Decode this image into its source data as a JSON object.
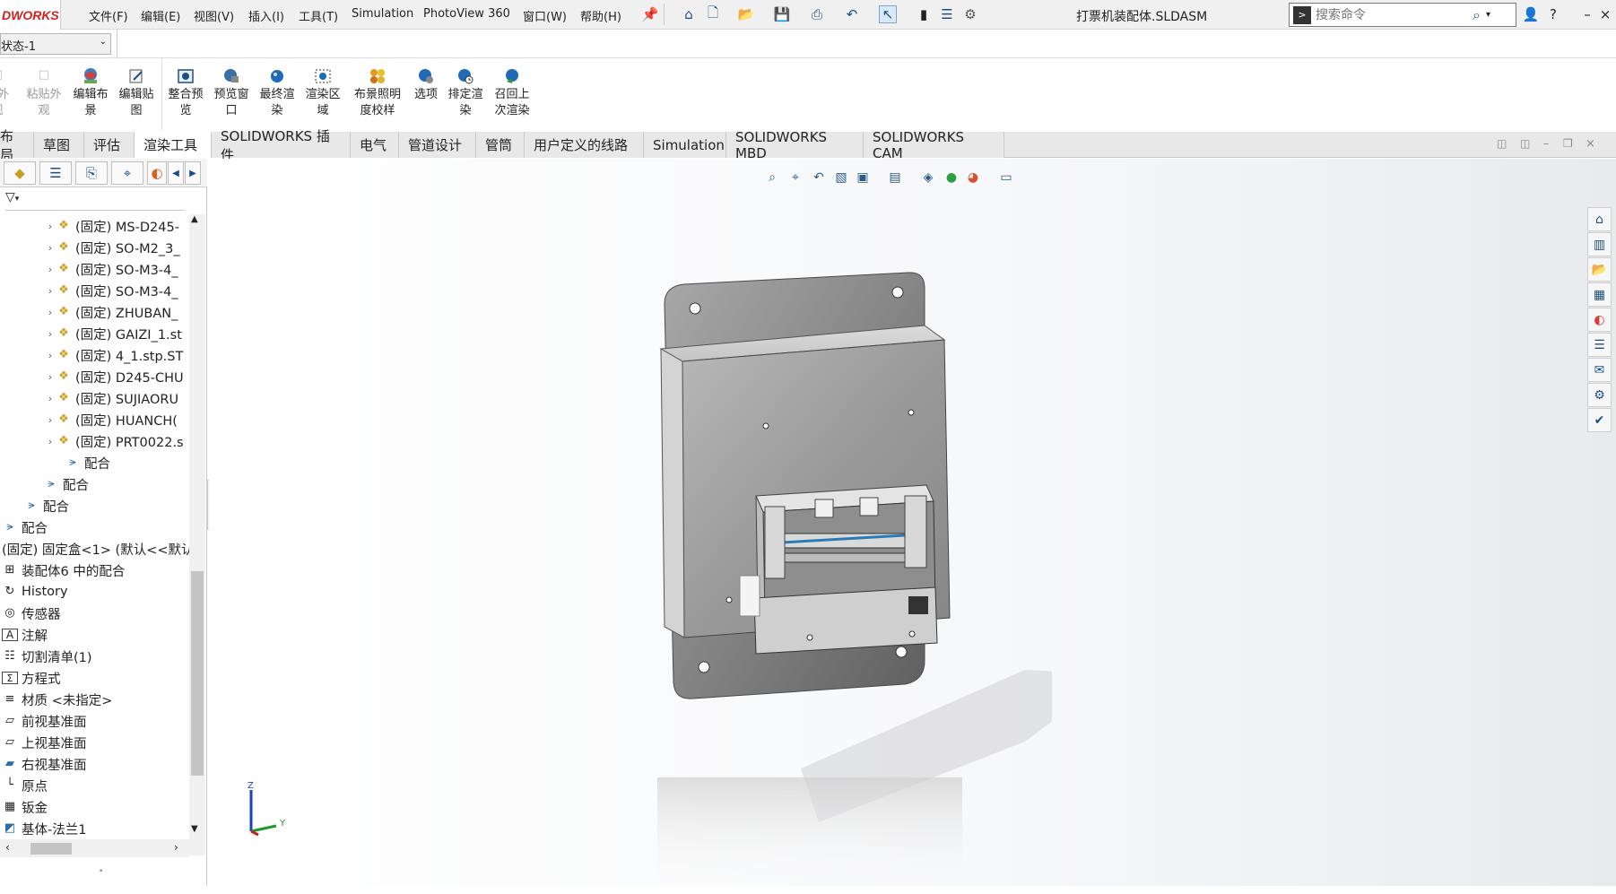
{
  "app": {
    "logo_text": "DWORKS",
    "document_title": "打票机装配体.SLDASM"
  },
  "menu": [
    "文件(F)",
    "编辑(E)",
    "视图(V)",
    "插入(I)",
    "工具(T)",
    "Simulation",
    "PhotoView 360",
    "窗口(W)",
    "帮助(H)"
  ],
  "search": {
    "placeholder": "搜索命令"
  },
  "config": {
    "value": "状态-1"
  },
  "ribbon": {
    "buttons": [
      {
        "label": "编辑布\n景",
        "icon": "scene-icon"
      },
      {
        "label": "编辑贴\n图",
        "icon": "decal-icon"
      },
      {
        "label": "整合预\n览",
        "icon": "integrated-preview-icon"
      },
      {
        "label": "预览窗\n口",
        "icon": "preview-window-icon"
      },
      {
        "label": "最终渲\n染",
        "icon": "final-render-icon"
      },
      {
        "label": "渲染区\n域",
        "icon": "render-region-icon"
      },
      {
        "label": "布景照明\n度校样",
        "icon": "scene-illumination-icon"
      },
      {
        "label": "选项",
        "icon": "options-icon"
      },
      {
        "label": "排定渲\n染",
        "icon": "schedule-render-icon"
      },
      {
        "label": "召回上\n次渲染",
        "icon": "recall-render-icon"
      }
    ],
    "disabled": [
      {
        "label": "粘贴外\n观"
      }
    ],
    "partial_left": "剪外\n观"
  },
  "tabs": [
    "布局",
    "草图",
    "评估",
    "渲染工具",
    "SOLIDWORKS 插件",
    "电气",
    "管道设计",
    "管筒",
    "用户定义的线路",
    "Simulation",
    "SOLIDWORKS MBD",
    "SOLIDWORKS CAM"
  ],
  "active_tab": "渲染工具",
  "tree": {
    "components": [
      "(固定) MS-D245-",
      "(固定) SO-M2_3_",
      "(固定) SO-M3-4_",
      "(固定) SO-M3-4_",
      "(固定) ZHUBAN_",
      "(固定) GAIZI_1.st",
      "(固定) 4_1.stp.ST",
      "(固定) D245-CHU",
      "(固定) SUJIAORU",
      "(固定) HUANCH(",
      "(固定) PRT0022.s"
    ],
    "mates": [
      "配合",
      "配合",
      "配合",
      "配合"
    ],
    "root_items": [
      {
        "label": "(固定) 固定盒<1> (默认<<默认",
        "icon": "part-icon"
      },
      {
        "label": "装配体6 中的配合",
        "icon": "mates-folder-icon"
      },
      {
        "label": "History",
        "icon": "history-icon"
      },
      {
        "label": "传感器",
        "icon": "sensor-icon"
      },
      {
        "label": "注解",
        "icon": "annotation-icon"
      },
      {
        "label": "切割清单(1)",
        "icon": "cut-list-icon"
      },
      {
        "label": "方程式",
        "icon": "equation-icon"
      },
      {
        "label": "材质 <未指定>",
        "icon": "material-icon"
      },
      {
        "label": "前视基准面",
        "icon": "plane-icon"
      },
      {
        "label": "上视基准面",
        "icon": "plane-icon"
      },
      {
        "label": "右视基准面",
        "icon": "plane-icon"
      },
      {
        "label": "原点",
        "icon": "origin-icon"
      },
      {
        "label": "钣金",
        "icon": "sheet-metal-icon"
      },
      {
        "label": "基体-法兰1",
        "icon": "base-flange-icon"
      }
    ]
  },
  "triad": {
    "z": "Z",
    "y": "Y"
  },
  "colors": {
    "accent": "#1c4f8a",
    "logo": "#d42020"
  }
}
